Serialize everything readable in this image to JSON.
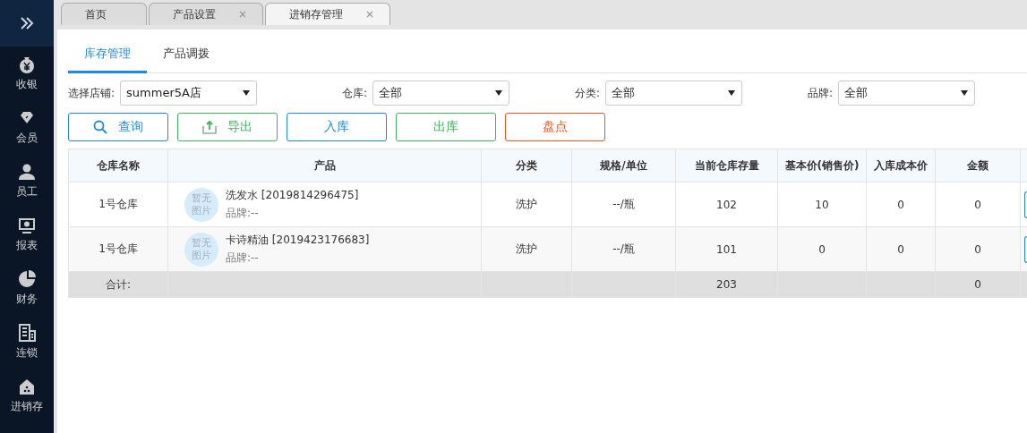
{
  "sidebar": {
    "items": [
      {
        "label": "收银"
      },
      {
        "label": "会员"
      },
      {
        "label": "员工"
      },
      {
        "label": "报表"
      },
      {
        "label": "财务"
      },
      {
        "label": "连锁"
      },
      {
        "label": "进销存"
      }
    ]
  },
  "tabs": [
    {
      "label": "首页",
      "closable": false,
      "selected": false
    },
    {
      "label": "产品设置",
      "closable": true,
      "selected": false
    },
    {
      "label": "进销存管理",
      "closable": true,
      "selected": true
    }
  ],
  "subtabs": [
    {
      "label": "库存管理",
      "selected": true
    },
    {
      "label": "产品调拨",
      "selected": false
    }
  ],
  "filters": [
    {
      "label": "选择店铺:",
      "value": "summer5A店"
    },
    {
      "label": "仓库:",
      "value": "全部"
    },
    {
      "label": "分类:",
      "value": "全部"
    },
    {
      "label": "品牌:",
      "value": "全部"
    }
  ],
  "buttons": [
    {
      "label": "查询",
      "kind": "search",
      "color": "#1e88e5"
    },
    {
      "label": "导出",
      "kind": "export",
      "color": "#3cb35c"
    },
    {
      "label": "入库",
      "kind": "plain",
      "color": "#1e88e5"
    },
    {
      "label": "出库",
      "kind": "plain",
      "color": "#3cb35c"
    },
    {
      "label": "盘点",
      "kind": "plain",
      "color": "#f4511e"
    }
  ],
  "table": {
    "columns": [
      "仓库名称",
      "产品",
      "分类",
      "规格/单位",
      "当前仓库存量",
      "基本价(销售价)",
      "入库成本价",
      "金额"
    ],
    "rows": [
      {
        "warehouse": "1号仓库",
        "image_text": "暂无图片",
        "product": "洗发水 [2019814296475]",
        "brand": "品牌:--",
        "category": "洗护",
        "spec": "--/瓶",
        "stock": "102",
        "base_price": "10",
        "cost_price": "0",
        "amount": "0"
      },
      {
        "warehouse": "1号仓库",
        "image_text": "暂无图片",
        "product": "卡诗精油 [2019423176683]",
        "brand": "品牌:--",
        "category": "洗护",
        "spec": "--/瓶",
        "stock": "101",
        "base_price": "0",
        "cost_price": "0",
        "amount": "0"
      }
    ],
    "total": {
      "label": "合计:",
      "stock": "203",
      "amount": "0"
    }
  }
}
